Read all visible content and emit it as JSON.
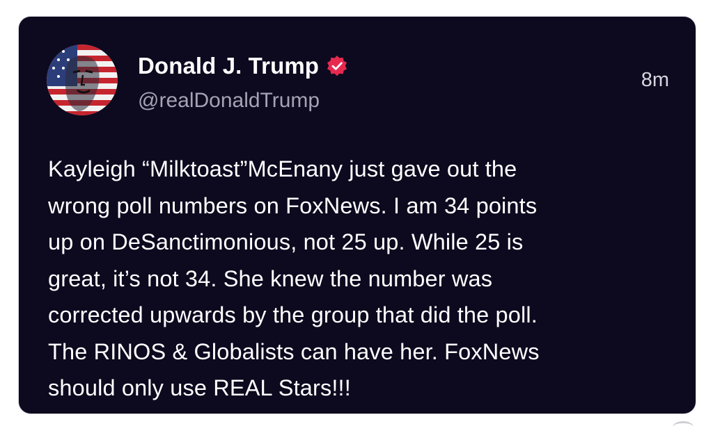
{
  "post": {
    "author_name": "Donald J. Trump",
    "author_handle": "@realDonaldTrump",
    "timestamp": "8m",
    "verified": true,
    "body_text": "Kayleigh “Milktoast”McEnany just gave out the\nwrong poll numbers on FoxNews. I am 34 points\nup on DeSanctimonious, not 25 up. While 25 is\ngreat, it’s not 34. She knew the number was\ncorrected upwards by the group that did the poll.\nThe RINOS & Globalists can have her. FoxNews\nshould only use REAL Stars!!!"
  },
  "icons": {
    "avatar": "flag-portrait-avatar",
    "verified": "verified-badge-icon"
  },
  "colors": {
    "card_background": "#0d0a1f",
    "verified_badge": "#e8294f",
    "handle_text": "#a6a2b5"
  }
}
